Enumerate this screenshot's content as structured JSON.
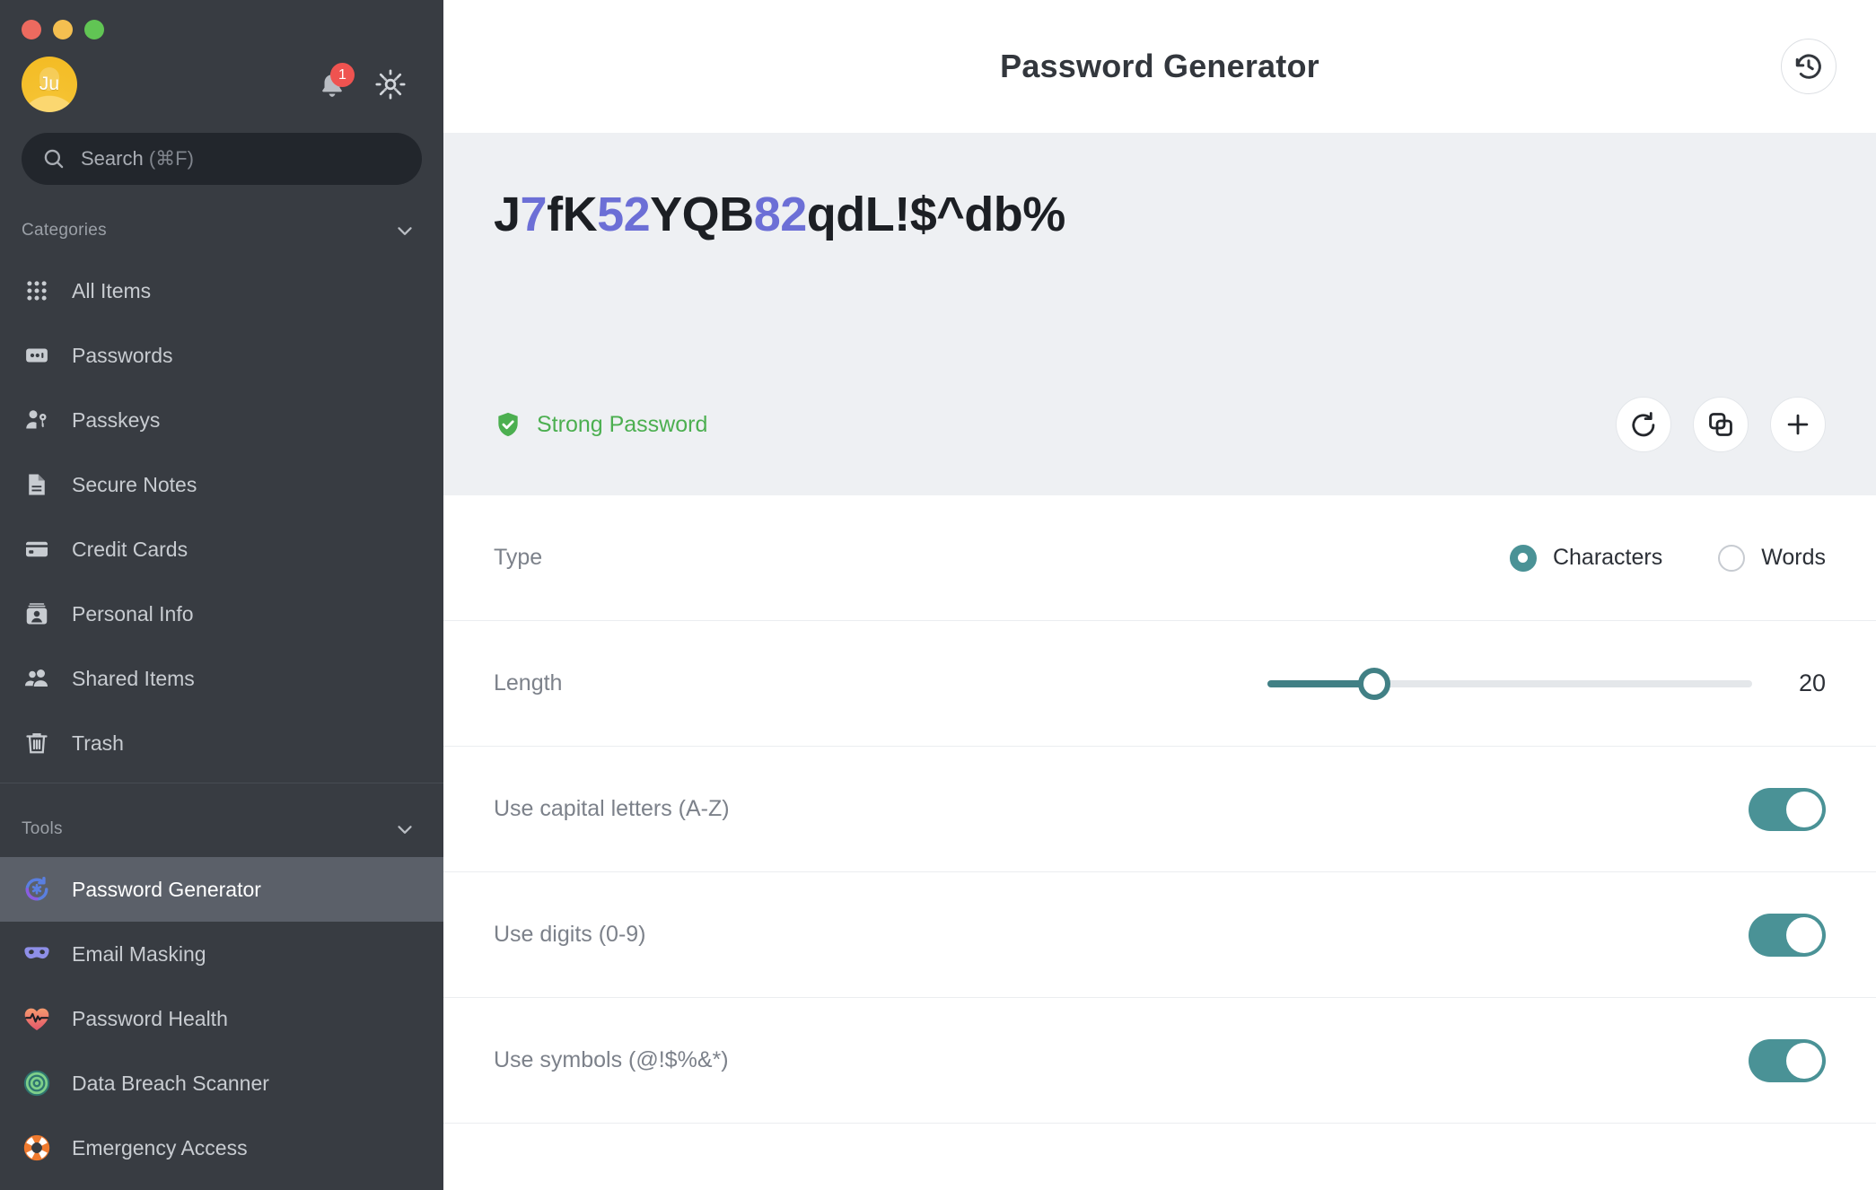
{
  "window": {
    "traffic_lights": [
      "close",
      "minimize",
      "maximize"
    ]
  },
  "sidebar": {
    "account": {
      "avatar_initials": "Ju",
      "notification_count": "1",
      "notification_icon": "bell-icon",
      "settings_icon": "gear-icon"
    },
    "search": {
      "placeholder_text": "Search",
      "shortcut": "(⌘F)",
      "icon": "search-icon"
    },
    "categories_section": {
      "title": "Categories",
      "chevron": "chevron-down-icon",
      "items": [
        {
          "label": "All Items",
          "icon": "grid-icon"
        },
        {
          "label": "Passwords",
          "icon": "password-field-icon"
        },
        {
          "label": "Passkeys",
          "icon": "person-key-icon"
        },
        {
          "label": "Secure Notes",
          "icon": "document-icon"
        },
        {
          "label": "Credit Cards",
          "icon": "credit-card-icon"
        },
        {
          "label": "Personal Info",
          "icon": "id-card-icon"
        },
        {
          "label": "Shared Items",
          "icon": "people-icon"
        },
        {
          "label": "Trash",
          "icon": "trash-icon"
        }
      ]
    },
    "tools_section": {
      "title": "Tools",
      "chevron": "chevron-down-icon",
      "items": [
        {
          "label": "Password Generator",
          "icon": "refresh-asterisk-icon",
          "active": true
        },
        {
          "label": "Email Masking",
          "icon": "mask-icon",
          "active": false
        },
        {
          "label": "Password Health",
          "icon": "heart-pulse-icon",
          "active": false
        },
        {
          "label": "Data Breach Scanner",
          "icon": "target-icon",
          "active": false
        },
        {
          "label": "Emergency Access",
          "icon": "life-ring-icon",
          "active": false
        }
      ]
    }
  },
  "main": {
    "title": "Password Generator",
    "history_button_icon": "history-clock-icon",
    "password": {
      "value": "J7fK52YQB82qdL!$^db%",
      "segments": [
        {
          "text": "J",
          "kind": "letter"
        },
        {
          "text": "7",
          "kind": "digit"
        },
        {
          "text": "fK",
          "kind": "letter"
        },
        {
          "text": "52",
          "kind": "digit"
        },
        {
          "text": "YQB",
          "kind": "letter"
        },
        {
          "text": "82",
          "kind": "digit"
        },
        {
          "text": "qdL!$^db%",
          "kind": "letter"
        }
      ],
      "strength_label": "Strong Password",
      "strength_icon": "shield-check-icon",
      "strength_color": "#4caf50",
      "digit_color": "#6c6fd6",
      "actions": [
        {
          "name": "regenerate",
          "icon": "refresh-icon"
        },
        {
          "name": "copy",
          "icon": "copy-icon"
        },
        {
          "name": "add",
          "icon": "plus-icon"
        }
      ]
    },
    "settings": {
      "type": {
        "label": "Type",
        "options": [
          {
            "label": "Characters",
            "selected": true
          },
          {
            "label": "Words",
            "selected": false
          }
        ]
      },
      "length": {
        "label": "Length",
        "value": "20",
        "fill_percent": 22
      },
      "toggles": [
        {
          "label": "Use capital letters (A-Z)",
          "on": true
        },
        {
          "label": "Use digits (0-9)",
          "on": true
        },
        {
          "label": "Use symbols (@!$%&*)",
          "on": true
        }
      ]
    },
    "accent_color": "#4a9296"
  }
}
